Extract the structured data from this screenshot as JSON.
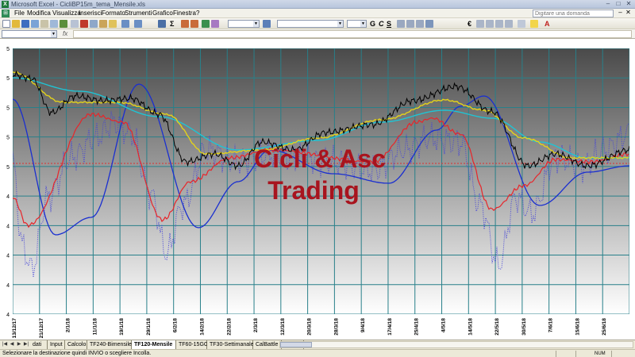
{
  "window": {
    "title": "Microsoft Excel - CicliBP15m_tema_Mensile.xls",
    "min_glyph": "‒",
    "max_glyph": "□",
    "close_glyph": "✕"
  },
  "menu": {
    "items": [
      "File",
      "Modifica",
      "Visualizza",
      "Inserisci",
      "Formato",
      "Strumenti",
      "Grafico",
      "Finestra",
      "?"
    ],
    "help_placeholder": "Digitare una domanda"
  },
  "chart": {
    "watermark_line1": "Cicli & Asc",
    "watermark_line2": "Trading",
    "watermark_color": "#a8141e",
    "y_tick_labels": [
      "5",
      "5",
      "5",
      "5",
      "5",
      "4",
      "4",
      "4",
      "4",
      "4"
    ],
    "x_tick_labels": [
      "13/12/17",
      "21/12/17",
      "2/1/18",
      "11/1/18",
      "19/1/18",
      "29/1/18",
      "6/2/18",
      "14/2/18",
      "22/2/18",
      "2/3/18",
      "12/3/18",
      "20/3/18",
      "28/3/18",
      "9/4/18",
      "17/4/18",
      "25/4/18",
      "4/5/18",
      "14/5/18",
      "22/5/18",
      "30/5/18",
      "7/6/18",
      "15/6/18",
      "25/6/18"
    ],
    "colors": {
      "price": "#000000",
      "cyan": "#1fc4d4",
      "yellow": "#e3d21a",
      "red": "#e8252a",
      "blue": "#1a2fd0",
      "dotted": "#4545d8",
      "grid": "#28808a",
      "dashed": "#d83030"
    }
  },
  "sheet_tabs": [
    "dati",
    "Input",
    "Calcolo",
    "TF240-Bimensile",
    "TF120-Mensile",
    "TF60-15GG",
    "TF30-Settimanale",
    "CalBattle",
    "Macro1"
  ],
  "active_sheet": "TF120-Mensile",
  "status": {
    "message": "Selezionare la destinazione quindi INVIO o scegliere Incolla.",
    "num": "NUM"
  }
}
